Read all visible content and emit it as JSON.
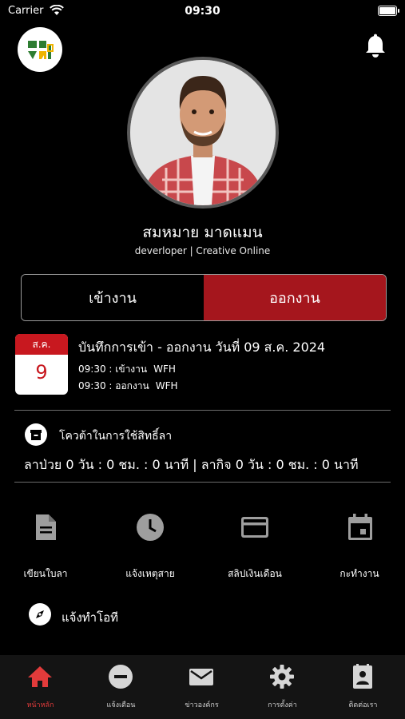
{
  "status_bar": {
    "carrier": "Carrier",
    "time": "09:30"
  },
  "profile": {
    "name": "สมหมาย มาดแมน",
    "role": "deverloper | Creative Online"
  },
  "attendance_toggle": {
    "check_in": "เข้างาน",
    "check_out": "ออกงาน",
    "selected": "check_out"
  },
  "record": {
    "calendar_month": "ส.ค.",
    "calendar_day": "9",
    "title": "บันทึกการเข้า - ออกงาน วันที่ 09 ส.ค. 2024",
    "entries": [
      {
        "time": "09:30",
        "type": "เข้างาน",
        "location": "WFH"
      },
      {
        "time": "09:30",
        "type": "ออกงาน",
        "location": "WFH"
      }
    ]
  },
  "leave_quota": {
    "title": "โควต้าในการใช้สิทธิ์ลา",
    "summary": "ลาป่วย 0 วัน : 0 ชม. : 0 นาที  | ลากิจ 0 วัน : 0 ชม. : 0 นาที"
  },
  "menu": [
    {
      "label": "เขียนใบลา",
      "icon": "document-icon"
    },
    {
      "label": "แจ้งเหตุสาย",
      "icon": "clock-icon"
    },
    {
      "label": "สลิปเงินเดือน",
      "icon": "credit-card-icon"
    },
    {
      "label": "กะทำงาน",
      "icon": "calendar-icon"
    }
  ],
  "report_ot": {
    "label": "แจ้งทำโอที",
    "icon": "compass-icon"
  },
  "tabs": [
    {
      "label": "หน้าหลัก",
      "icon": "home-icon",
      "active": true
    },
    {
      "label": "แจ้งเตือน",
      "icon": "minus-circle-icon",
      "active": false
    },
    {
      "label": "ข่าวองค์กร",
      "icon": "mail-icon",
      "active": false
    },
    {
      "label": "การตั้งค่า",
      "icon": "gear-icon",
      "active": false
    },
    {
      "label": "ติดต่อเรา",
      "icon": "contact-book-icon",
      "active": false
    }
  ],
  "colors": {
    "accent": "#a5161d",
    "active_tab": "#e23b3b",
    "background": "#000000"
  }
}
